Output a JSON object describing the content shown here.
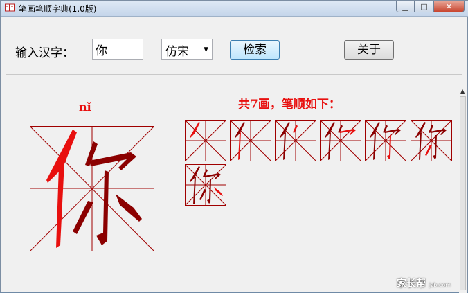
{
  "window": {
    "title": "笔画笔顺字典(1.0版)"
  },
  "titlebar_buttons": {
    "minimize": "▁",
    "maximize": "□",
    "close": "✕"
  },
  "toolbar": {
    "input_label": "输入汉字：",
    "char_value": "你",
    "font_value": "仿宋",
    "search_label": "检索",
    "about_label": "关于"
  },
  "character": {
    "pinyin": "nǐ",
    "glyph": "你",
    "stroke_heading": "共7画，笔顺如下：",
    "stroke_count": 7
  },
  "colors": {
    "stroke_red": "#e8100f",
    "stroke_dark": "#8b0000",
    "grid": "#a00000"
  },
  "watermark": {
    "text": "家长帮",
    "sub": "jzb.com"
  }
}
